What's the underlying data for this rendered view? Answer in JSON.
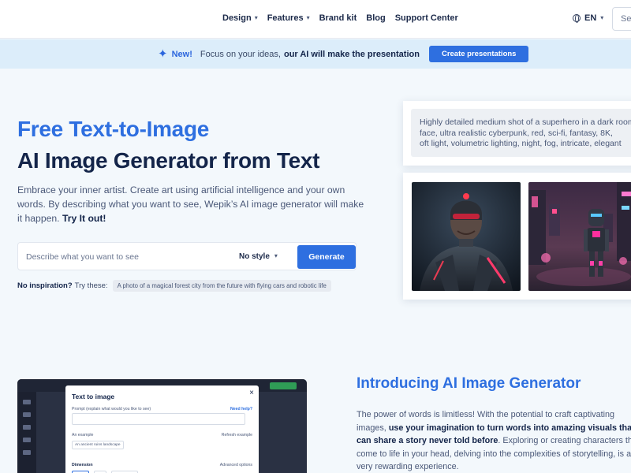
{
  "nav": {
    "items": [
      {
        "label": "Design",
        "dropdown": true
      },
      {
        "label": "Features",
        "dropdown": true
      },
      {
        "label": "Brand kit",
        "dropdown": false
      },
      {
        "label": "Blog",
        "dropdown": false
      },
      {
        "label": "Support Center",
        "dropdown": false
      }
    ],
    "language": "EN",
    "search_placeholder": "Search"
  },
  "banner": {
    "new_label": "New!",
    "text": "Focus on your ideas,",
    "bold_text": "our AI will make the presentation",
    "button": "Create presentations"
  },
  "hero": {
    "title_line1": "Free Text-to-Image",
    "title_line2": "AI Image Generator from Text",
    "description": "Embrace your inner artist. Create art using artificial intelligence and your own words. By describing what you want to see, Wepik’s AI image generator will make it happen.",
    "description_bold": "Try It out!",
    "input_placeholder": "Describe what you want to see",
    "style_label": "No style",
    "generate_button": "Generate",
    "no_inspiration": "No inspiration?",
    "try_these": "Try these:",
    "suggestion": "A photo of a magical forest city from the future with flying cars and robotic life"
  },
  "preview": {
    "prompt_lines": [
      "Highly detailed medium shot of a superhero in a dark room",
      "face, ultra realistic cyberpunk, red, sci-fi, fantasy, 8K,",
      "oft light, volumetric lighting, night, fog, intricate, elegant"
    ]
  },
  "editor": {
    "dialog_title": "Text to image",
    "prompt_label": "Prompt (explain what would you like to see)",
    "help_link": "Need help?",
    "example_label": "An example",
    "refresh_label": "Refresh example",
    "example_chip": "An ancient ruins landscape",
    "dimension_label": "Dimension",
    "advanced_label": "Advanced options",
    "close_label": "×"
  },
  "intro": {
    "title": "Introducing AI Image Generator",
    "text1": "The power of words is limitless! With the potential to craft captivating images,",
    "bold": "use your imagination to turn words into amazing visuals that can share a story never told before",
    "text2": ". Exploring or creating characters that come to life in your head, delving into the complexities of storytelling, is a very rewarding experience."
  },
  "colors": {
    "accent": "#2e6fe0",
    "navy": "#14254a",
    "banner_bg": "#dcedfa"
  }
}
